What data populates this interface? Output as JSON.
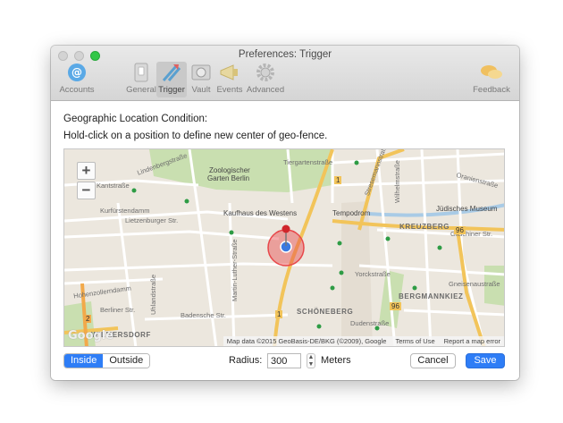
{
  "window": {
    "title": "Preferences: Trigger"
  },
  "toolbar": {
    "accounts": "Accounts",
    "general": "General",
    "trigger": "Trigger",
    "vault": "Vault",
    "events": "Events",
    "advanced": "Advanced",
    "feedback": "Feedback",
    "selected": "Trigger"
  },
  "content": {
    "heading": "Geographic Location Condition:",
    "hint": "Hold-click on a position to define new center of geo-fence."
  },
  "map": {
    "zoom_in": "+",
    "zoom_out": "−",
    "labels": {
      "lindenbergstrasse": "Lindenbergstraße",
      "tiergartenstrasse": "Tiergartenstraße",
      "zoo": "Zoologischer",
      "zoo2": "Garten Berlin",
      "kantstrasse": "Kantstraße",
      "kurfuerstendamm": "Kurfürstendamm",
      "lietzenburger": "Lietzenburger Str.",
      "kadewe": "Kaufhaus des Westens",
      "tempodrom": "Tempodrom",
      "kreuzberg": "KREUZBERG",
      "juedisches": "Jüdisches Museum",
      "oranienstrasse": "Oranienstraße",
      "gitschiner": "Gitschiner Str.",
      "stresemann": "Stresemannstraße",
      "wilhelm": "Wilhelmstraße",
      "hohenzollerndamm": "Hohenzollerndamm",
      "berliner": "Berliner Str.",
      "uhland": "Uhlandstraße",
      "martinluther": "Martin-Luther-Straße",
      "badensche": "Badensche Str.",
      "yorck": "Yorckstraße",
      "bergmannkiez": "BERGMANNKIEZ",
      "gneisenau": "Gneisenaustraße",
      "schoeneberg": "SCHÖNEBERG",
      "dudenstrasse": "Dudenstraße",
      "wilmersdorf": "WILMERSDORF",
      "r96": "96",
      "r1a": "1",
      "r1b": "1",
      "r96b": "96",
      "r2": "2"
    },
    "google_logo": "Google",
    "attribution": {
      "data": "Map data ©2015 GeoBasis-DE/BKG (©2009), Google",
      "terms": "Terms of Use",
      "report": "Report a map error"
    },
    "geofence_color": "#e8474a",
    "pin_color": "#d0252b",
    "location_color": "#3b7ae0"
  },
  "controls": {
    "inside": "Inside",
    "outside": "Outside",
    "mode": "Inside",
    "radius_label": "Radius:",
    "radius_value": "300",
    "meters": "Meters",
    "cancel": "Cancel",
    "save": "Save"
  }
}
